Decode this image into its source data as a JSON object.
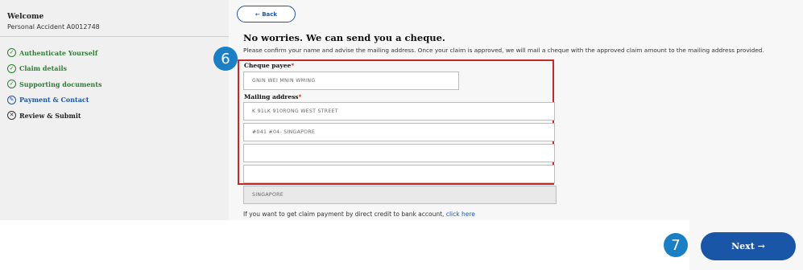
{
  "sidebar": {
    "welcome": "Welcome",
    "policy": "Personal Accident A0012748",
    "steps": [
      {
        "label": "Authenticate Yourself",
        "icon": "✓"
      },
      {
        "label": "Claim details",
        "icon": "✓"
      },
      {
        "label": "Supporting documents",
        "icon": "✓"
      },
      {
        "label": "Payment & Contact",
        "icon": "✎"
      },
      {
        "label": "Review & Submit",
        "icon": "✕"
      }
    ]
  },
  "main": {
    "back_label": "← Back",
    "heading": "No worries. We can send you a cheque.",
    "subtext": "Please confirm your name and advise the mailing address. Once your claim is approved, we will mail a cheque with the approved claim amount to the mailing address provided.",
    "payee_label": "Cheque payee",
    "payee_value": "GNIN WEI MNIN WMING",
    "mailing_label": "Mailing address",
    "required_mark": "*",
    "address": [
      "K 91LK 910RONG WEST STREET",
      "#041 #04- SINGAPORE",
      "",
      "",
      "SINGAPORE"
    ],
    "direct_credit_text": "If you want to get claim payment by direct credit to bank account,",
    "direct_credit_link": "click here"
  },
  "annotations": {
    "badge_6": "6",
    "badge_7": "7"
  },
  "footer": {
    "next_label": "Next →"
  },
  "colors": {
    "primary": "#1a56a8",
    "success": "#2e7d32",
    "highlight": "#c62828",
    "badge": "#1a7fc4"
  }
}
